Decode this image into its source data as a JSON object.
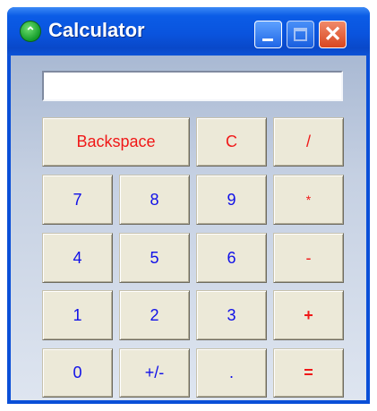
{
  "window": {
    "title": "Calculator",
    "icon": "calculator-app-icon",
    "controls": [
      "minimize",
      "maximize",
      "close"
    ]
  },
  "display": {
    "value": ""
  },
  "keys": {
    "backspace": "Backspace",
    "clear": "C",
    "divide": "/",
    "seven": "7",
    "eight": "8",
    "nine": "9",
    "multiply": "*",
    "four": "4",
    "five": "5",
    "six": "6",
    "subtract": "-",
    "one": "1",
    "two": "2",
    "three": "3",
    "add": "+",
    "zero": "0",
    "sign": "+/-",
    "decimal": ".",
    "equals": "="
  },
  "colors": {
    "operator_text": "#f01818",
    "digit_text": "#1010e8",
    "button_face": "#ece9d8",
    "titlebar": "#0a54de"
  }
}
